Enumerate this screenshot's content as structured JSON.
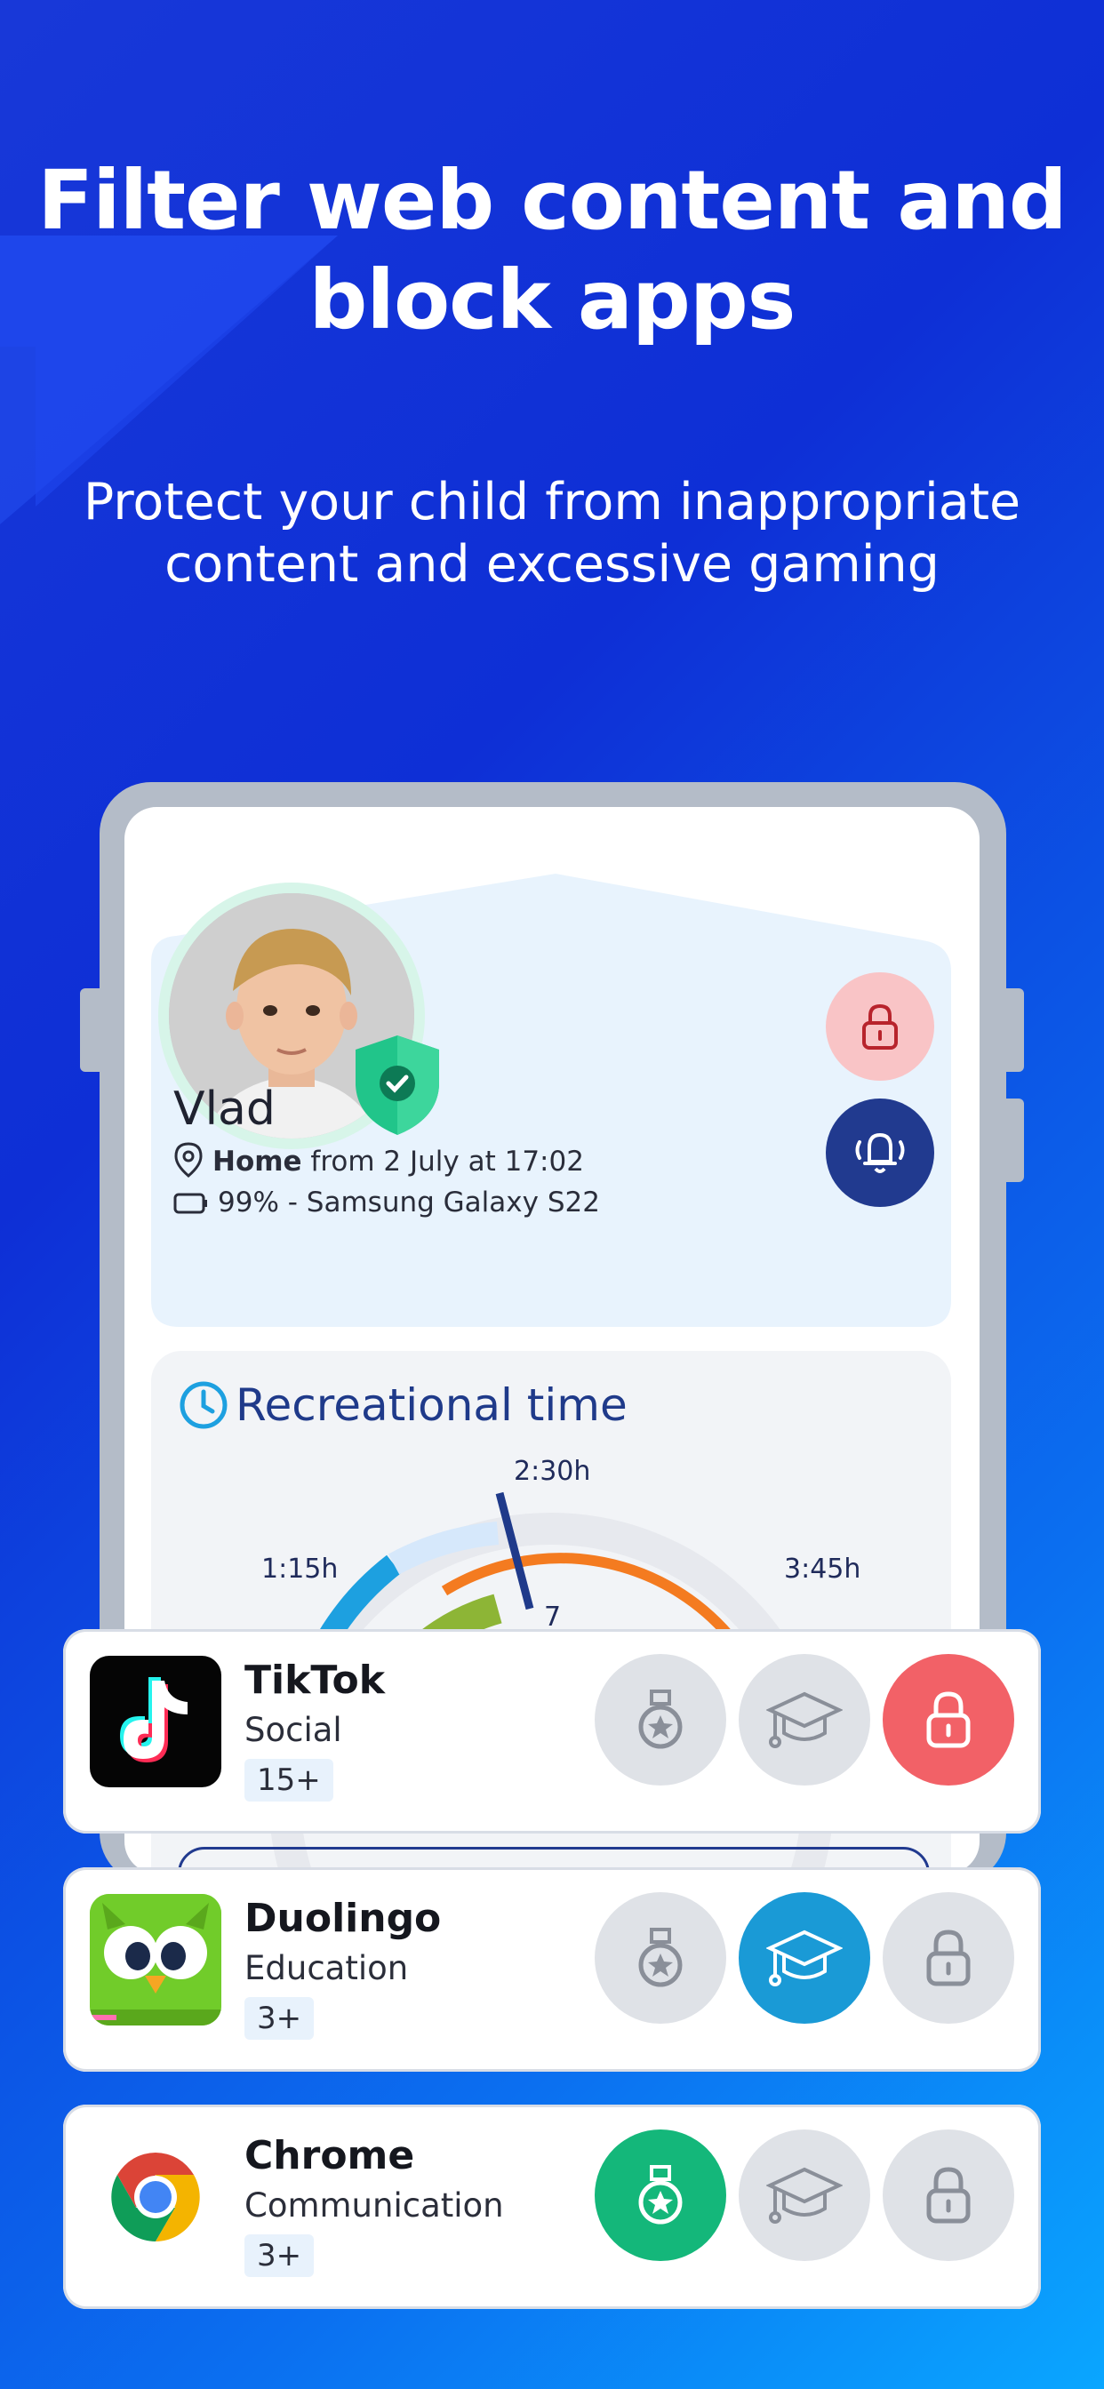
{
  "hero": {
    "title_line1": "Filter web content and",
    "title_line2": "block apps",
    "subtitle_line1": "Protect your child from inappropriate",
    "subtitle_line2": "content and excessive gaming"
  },
  "profile": {
    "name": "Vlad",
    "location_bold": "Home",
    "location_rest": " from 2 July at 17:02",
    "device": "99% - Samsung Galaxy S22"
  },
  "recreational": {
    "title": "Recreational time",
    "tick_top": "2:30h",
    "tick_left": "1:15h",
    "tick_right": "3:45h",
    "inner_value": "7"
  },
  "apps": [
    {
      "name": "TikTok",
      "category": "Social",
      "age": "15+"
    },
    {
      "name": "Duolingo",
      "category": "Education",
      "age": "3+"
    },
    {
      "name": "Chrome",
      "category": "Communication",
      "age": "3+"
    }
  ],
  "colors": {
    "lock_active": "#f26167",
    "education_active": "#1a9ad6",
    "allowed_active": "#14b77a",
    "inactive": "#dfe2e7",
    "sos_button": "#213a8f"
  }
}
